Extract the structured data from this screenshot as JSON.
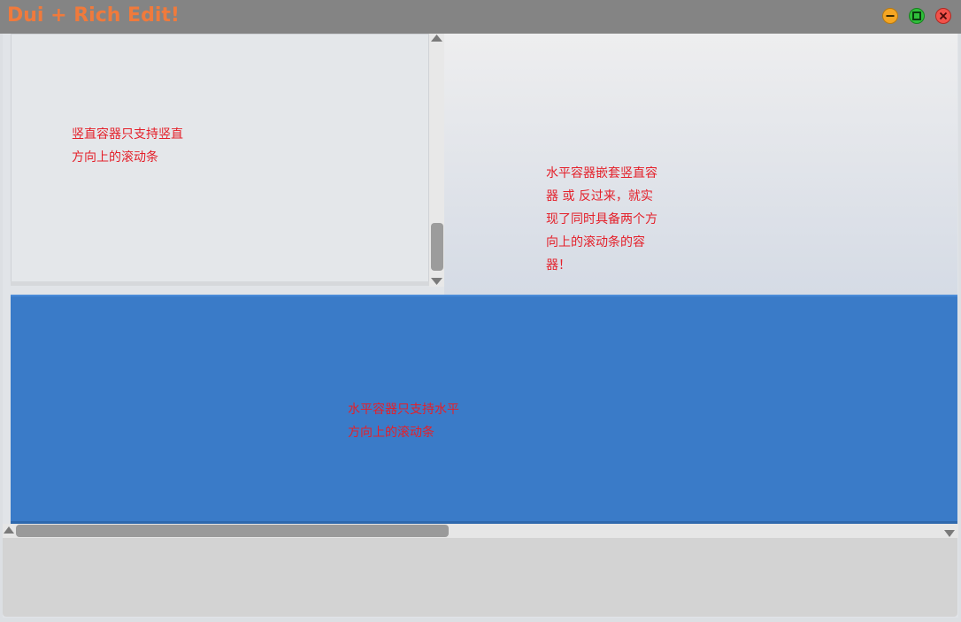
{
  "window": {
    "title": "Dui + Rich Edit!",
    "title_color": "#f07a3c"
  },
  "controls": {
    "minimize_icon": "minimize-icon",
    "maximize_icon": "maximize-icon",
    "close_icon": "close-icon"
  },
  "vertical_container": {
    "text": "竖直容器只支持竖直\n方向上的滚动条"
  },
  "nested_container": {
    "text": "水平容器嵌套竖直容\n器 或 反过来，就实\n现了同时具备两个方\n向上的滚动条的容\n器！"
  },
  "horizontal_container": {
    "text": "水平容器只支持水平\n方向上的滚动条",
    "background": "#3a7bc8"
  },
  "colors": {
    "accent_text": "#e4202a"
  }
}
